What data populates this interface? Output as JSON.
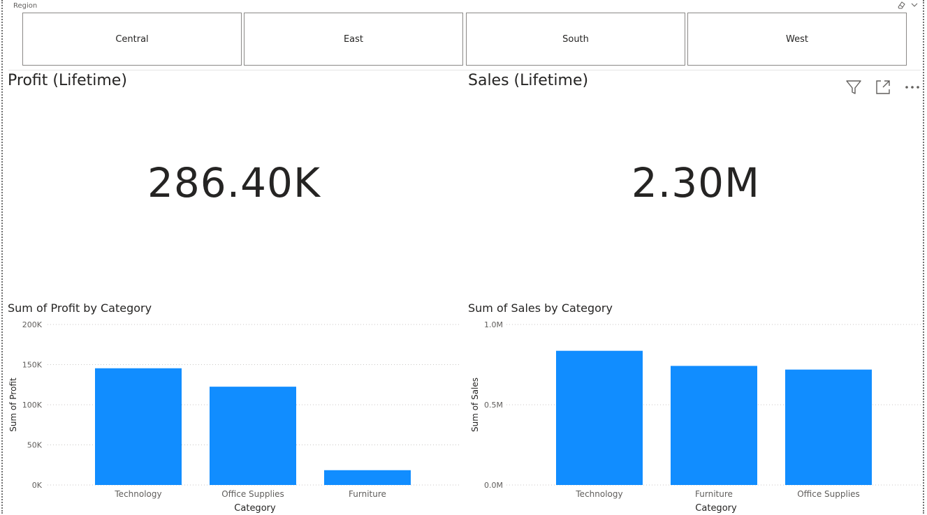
{
  "slicer": {
    "title": "Region",
    "items": [
      "Central",
      "East",
      "South",
      "West"
    ],
    "eraser_icon": "eraser-icon",
    "chevron_icon": "chevron-down-icon"
  },
  "cards": {
    "profit": {
      "title": "Profit (Lifetime)",
      "value": "286.40K"
    },
    "sales": {
      "title": "Sales (Lifetime)",
      "value": "2.30M"
    }
  },
  "visual_header": {
    "icons": [
      "filter-icon",
      "focus-mode-icon",
      "more-options-icon"
    ]
  },
  "colors": {
    "bar": "#118DFF",
    "grid": "#c8c6c4",
    "text": "#252423",
    "axis_text": "#605e5c"
  },
  "chart_data": [
    {
      "type": "bar",
      "title": "Sum of Profit by Category",
      "xlabel": "Category",
      "ylabel": "Sum of Profit",
      "categories": [
        "Technology",
        "Office Supplies",
        "Furniture"
      ],
      "values": [
        145455,
        122491,
        18451
      ],
      "ylim": [
        0,
        200000
      ],
      "yticks": [
        {
          "value": 0,
          "label": "0K"
        },
        {
          "value": 50000,
          "label": "50K"
        },
        {
          "value": 100000,
          "label": "100K"
        },
        {
          "value": 150000,
          "label": "150K"
        },
        {
          "value": 200000,
          "label": "200K"
        }
      ],
      "grid": true
    },
    {
      "type": "bar",
      "title": "Sum of Sales by Category",
      "xlabel": "Category",
      "ylabel": "Sum of Sales",
      "categories": [
        "Technology",
        "Furniture",
        "Office Supplies"
      ],
      "values": [
        836154,
        741999,
        719047
      ],
      "ylim": [
        0,
        1000000
      ],
      "yticks": [
        {
          "value": 0,
          "label": "0.0M"
        },
        {
          "value": 500000,
          "label": "0.5M"
        },
        {
          "value": 1000000,
          "label": "1.0M"
        }
      ],
      "grid": true
    }
  ]
}
